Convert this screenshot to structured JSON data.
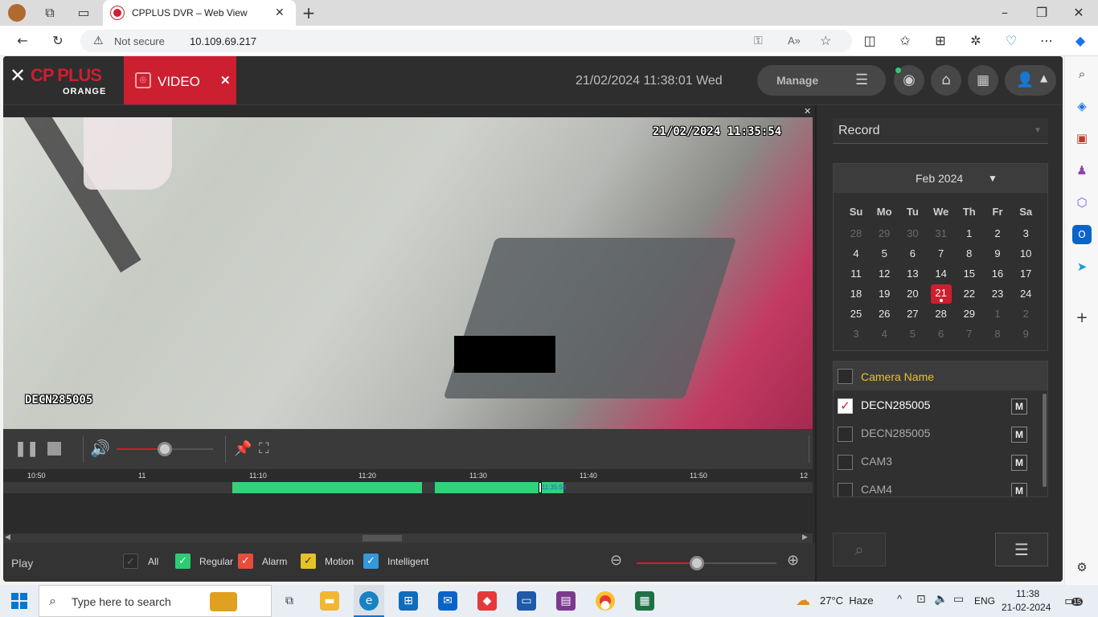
{
  "browser": {
    "tab_title": "CPPLUS DVR – Web View",
    "not_secure": "Not secure",
    "url": "10.109.69.217"
  },
  "header": {
    "brand": "CP PLUS",
    "brand_sub": "ORANGE",
    "active_tab": "VIDEO",
    "datetime": "21/02/2024 11:38:01 Wed",
    "manage_label": "Manage"
  },
  "video": {
    "osd_timestamp": "21/02/2024 11:35:54",
    "osd_camera": "DECN285005"
  },
  "timeline": {
    "ticks": [
      "10:50",
      "11",
      "11:10",
      "11:20",
      "11:30",
      "11:40",
      "11:50",
      "12"
    ],
    "cursor_time": "11:35:54"
  },
  "footer": {
    "mode": "Play",
    "legend": [
      {
        "label": "All",
        "checked": false,
        "color": "#2b2b2b"
      },
      {
        "label": "Regular",
        "checked": true,
        "color": "#2ecc71"
      },
      {
        "label": "Alarm",
        "checked": true,
        "color": "#e74c3c"
      },
      {
        "label": "Motion",
        "checked": true,
        "color": "#e6c229"
      },
      {
        "label": "Intelligent",
        "checked": true,
        "color": "#3498db"
      }
    ],
    "volume_level": 0.5,
    "zoom_level": 0.43
  },
  "right_panel": {
    "record_type": "Record",
    "calendar": {
      "month_label": "Feb 2024",
      "weekdays": [
        "Su",
        "Mo",
        "Tu",
        "We",
        "Th",
        "Fr",
        "Sa"
      ],
      "weeks": [
        [
          "28",
          "29",
          "30",
          "31",
          "1",
          "2",
          "3"
        ],
        [
          "4",
          "5",
          "6",
          "7",
          "8",
          "9",
          "10"
        ],
        [
          "11",
          "12",
          "13",
          "14",
          "15",
          "16",
          "17"
        ],
        [
          "18",
          "19",
          "20",
          "21",
          "22",
          "23",
          "24"
        ],
        [
          "25",
          "26",
          "27",
          "28",
          "29",
          "1",
          "2"
        ],
        [
          "3",
          "4",
          "5",
          "6",
          "7",
          "8",
          "9"
        ]
      ],
      "selected": "21"
    },
    "camera_header": "Camera Name",
    "cameras": [
      {
        "name": "DECN285005",
        "checked": true
      },
      {
        "name": "DECN285005",
        "checked": false
      },
      {
        "name": "CAM3",
        "checked": false
      },
      {
        "name": "CAM4",
        "checked": false
      }
    ],
    "m_label": "M"
  },
  "taskbar": {
    "search_placeholder": "Type here to search",
    "weather": "27°C  Haze",
    "lang": "ENG",
    "time": "11:38",
    "date": "21-02-2024",
    "notif_count": "15"
  },
  "colors": {
    "brand_red": "#cc1f2f",
    "timeline_green": "#33d17a"
  }
}
